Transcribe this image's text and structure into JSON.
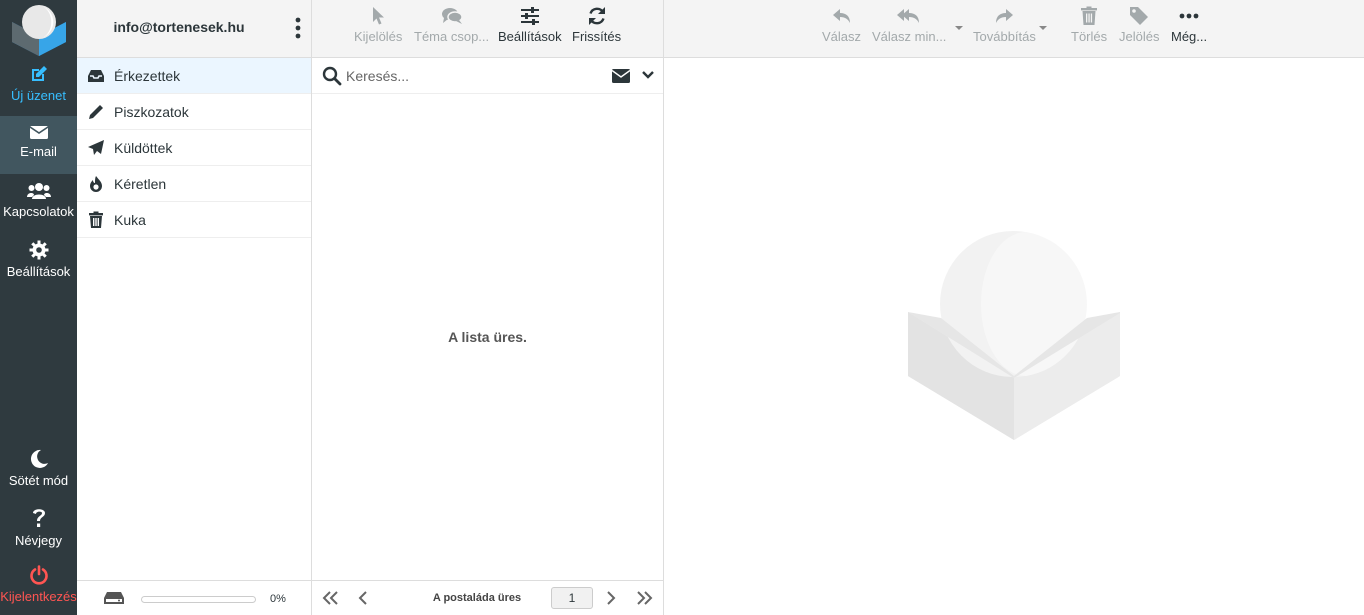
{
  "taskmenu": {
    "compose": "Új üzenet",
    "mail": "E-mail",
    "contacts": "Kapcsolatok",
    "settings": "Beállítások",
    "darkmode": "Sötét mód",
    "about": "Névjegy",
    "logout": "Kijelentkezés"
  },
  "account": {
    "email": "info@tortenesek.hu"
  },
  "folders": [
    {
      "name": "Érkezettek",
      "icon": "inbox-icon",
      "selected": true
    },
    {
      "name": "Piszkozatok",
      "icon": "pencil-icon"
    },
    {
      "name": "Küldöttek",
      "icon": "paper-plane-icon"
    },
    {
      "name": "Kéretlen",
      "icon": "fire-icon"
    },
    {
      "name": "Kuka",
      "icon": "trash-icon"
    }
  ],
  "quota": {
    "percent_text": "0%",
    "fraction": 0.0
  },
  "list_toolbar": {
    "select": "Kijelölés",
    "threads": "Téma csop...",
    "options": "Beállítások",
    "refresh": "Frissítés"
  },
  "search": {
    "placeholder": "Keresés..."
  },
  "list": {
    "empty_text": "A lista üres."
  },
  "pagination": {
    "status": "A postaláda üres",
    "page": "1"
  },
  "message_toolbar": {
    "reply": "Válasz",
    "reply_all": "Válasz min...",
    "forward": "Továbbítás",
    "delete": "Törlés",
    "mark": "Jelölés",
    "more": "Még..."
  },
  "colors": {
    "taskmenu_bg": "#2f3a3f",
    "accent": "#37beff",
    "logout": "#ff5552",
    "selected_folder_bg": "#ebf6ff"
  }
}
